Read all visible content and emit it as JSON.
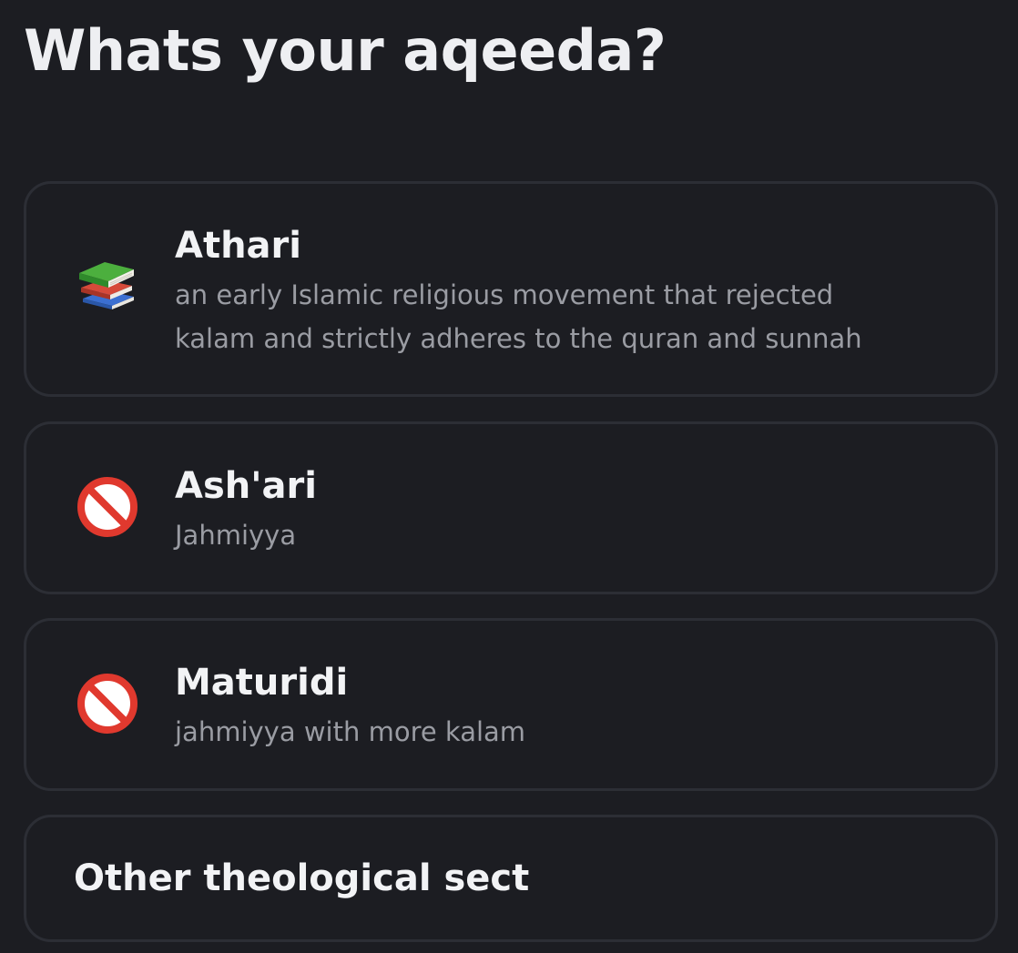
{
  "question": "Whats your aqeeda?",
  "options": [
    {
      "label": "Athari",
      "description": "an early Islamic religious movement that rejected\nkalam and strictly adheres to the quran and sunnah",
      "icon": "books-icon"
    },
    {
      "label": "Ash'ari",
      "description": "Jahmiyya",
      "icon": "prohibited-icon"
    },
    {
      "label": "Maturidi",
      "description": "jahmiyya with more kalam",
      "icon": "prohibited-icon"
    },
    {
      "label": "Other theological sect"
    }
  ],
  "colors": {
    "background": "#1c1d22",
    "card_border": "#2c2e35",
    "text_primary": "#f2f3f5",
    "text_secondary": "#9a9ca3",
    "prohibited_red": "#e0392e"
  }
}
